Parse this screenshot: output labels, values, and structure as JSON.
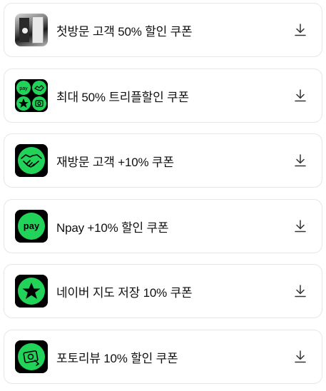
{
  "coupons": [
    {
      "label": "첫방문 고객 50% 할인 쿠폰",
      "icon": "store-photo-icon"
    },
    {
      "label": "최대 50% 트리플할인 쿠폰",
      "icon": "triple-benefit-icon"
    },
    {
      "label": "재방문 고객 +10% 쿠폰",
      "icon": "handshake-icon"
    },
    {
      "label": "Npay +10% 할인 쿠폰",
      "icon": "npay-icon"
    },
    {
      "label": "네이버 지도 저장 10% 쿠폰",
      "icon": "star-icon"
    },
    {
      "label": "포토리뷰 10% 할인 쿠폰",
      "icon": "photo-review-icon"
    }
  ],
  "colors": {
    "accent": "#22d35a",
    "icon_bg": "#000000",
    "border": "#e6e6e6"
  }
}
